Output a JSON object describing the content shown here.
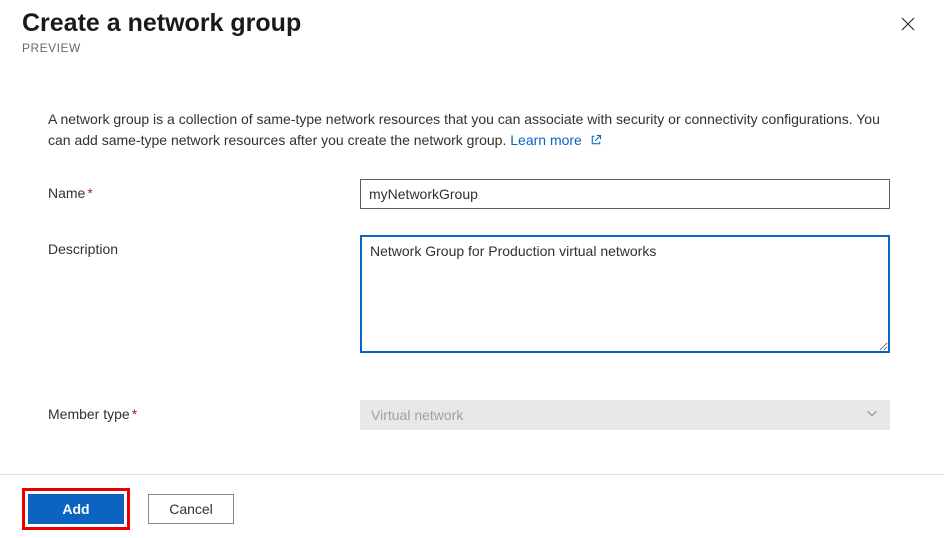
{
  "header": {
    "title": "Create a network group",
    "subtitle": "PREVIEW"
  },
  "intro": {
    "text": "A network group is a collection of same-type network resources that you can associate with security or connectivity configurations. You can add same-type network resources after you create the network group.",
    "learn_more": "Learn more"
  },
  "form": {
    "name_label": "Name",
    "name_value": "myNetworkGroup",
    "description_label": "Description",
    "description_value": "Network Group for Production virtual networks",
    "member_type_label": "Member type",
    "member_type_value": "Virtual network"
  },
  "footer": {
    "add_label": "Add",
    "cancel_label": "Cancel"
  }
}
